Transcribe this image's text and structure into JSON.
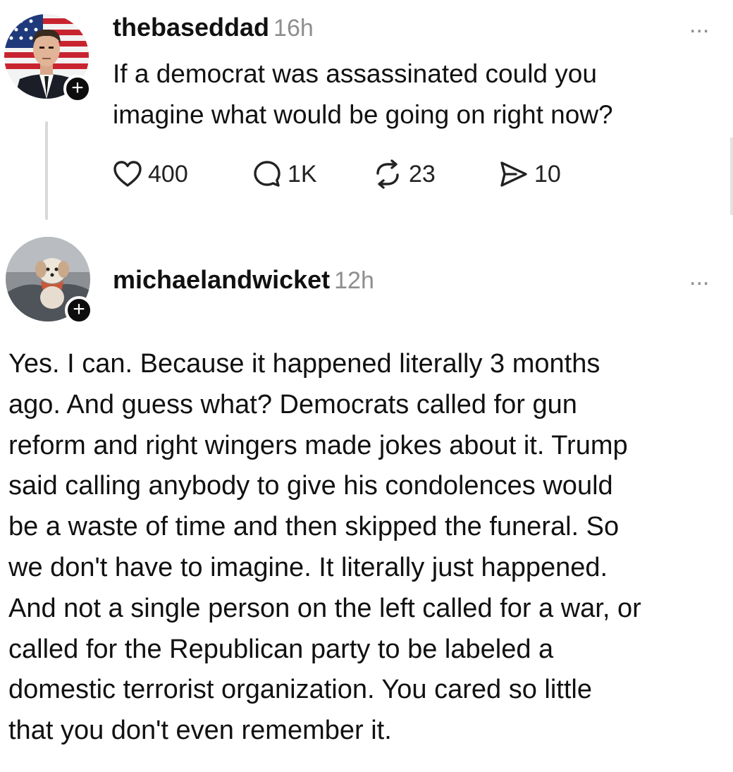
{
  "post": {
    "username": "thebaseddad",
    "time": "16h",
    "more": "...",
    "follow_icon": "+",
    "text": "If a democrat was assassinated could you\nimagine what would be going on right now?",
    "actions": {
      "likes": "400",
      "comments": "1K",
      "reposts": "23",
      "shares": "10"
    }
  },
  "reply": {
    "username": "michaelandwicket",
    "time": "12h",
    "more": "...",
    "follow_icon": "+",
    "text": "Yes. I can. Because it happened literally 3 months\nago. And guess what? Democrats called for gun\nreform and right wingers made jokes about it. Trump\nsaid calling anybody to give his condolences would\nbe a waste of time and then skipped the funeral. So\nwe don't have to imagine. It literally just happened.\nAnd not a single person on the left called for a war, or\ncalled for the Republican party to be labeled a\ndomestic terrorist organization. You cared so little\nthat you don't even remember it."
  },
  "icons": {
    "like": "heart-icon",
    "comment": "comment-icon",
    "repost": "repost-icon",
    "share": "share-icon",
    "more": "more-icon"
  }
}
